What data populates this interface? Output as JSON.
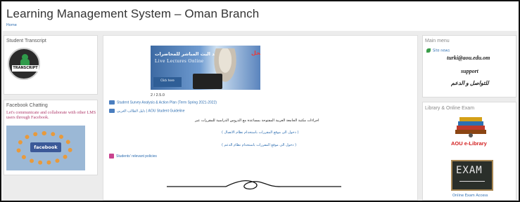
{
  "header": {
    "title": "Learning Management System – Oman Branch",
    "breadcrumb": "Home"
  },
  "left": {
    "transcript": {
      "title": "Student Transcript",
      "badge": "TRANSCRIPT"
    },
    "facebook": {
      "title": "Facebook Chatting",
      "text": "Let's communicate and collaborate with other LMS users through Facebook.",
      "badge": "facebook"
    }
  },
  "center": {
    "banner": {
      "ar": "شاهد البث المباشر للمحاضرات",
      "en": "Live Lectures Online",
      "logo": "الحل",
      "click": "Click here"
    },
    "page_counter": "2 / 2.5.0",
    "links": {
      "survey": "Student Survey Analysis & Action Plan (Term Spring 2021-2022)",
      "guideline": "دليل الطالب العربي | AOU Student Guideline",
      "policies": "Students' relevant policies"
    },
    "arabic": {
      "heading": "اجراءات مكتبة الجامعة العربية المفتوحة بمساعدة مع الدروس الدراسية للمقررات عبر",
      "link1": "( دخول الى موقع المقررات باستخدام نظام الاتصال )",
      "link2": "( دخول الى موقع المقررات باستخدام نظام الدعم )"
    }
  },
  "right": {
    "main_menu": {
      "title": "Main menu",
      "site_news": "Site news",
      "email": "turki@aou.edu.om",
      "support": "support",
      "contact_ar": "للتواصل و الدعم"
    },
    "library": {
      "title": "Library & Online Exam",
      "elibrary": "AOU e-Library",
      "exam": "EXAM",
      "exam_caption": "Online Exam Access"
    }
  },
  "colors": {
    "link": "#2b6cb0",
    "facebook_text": "#b03a6b",
    "elibrary_red": "#d32020"
  }
}
